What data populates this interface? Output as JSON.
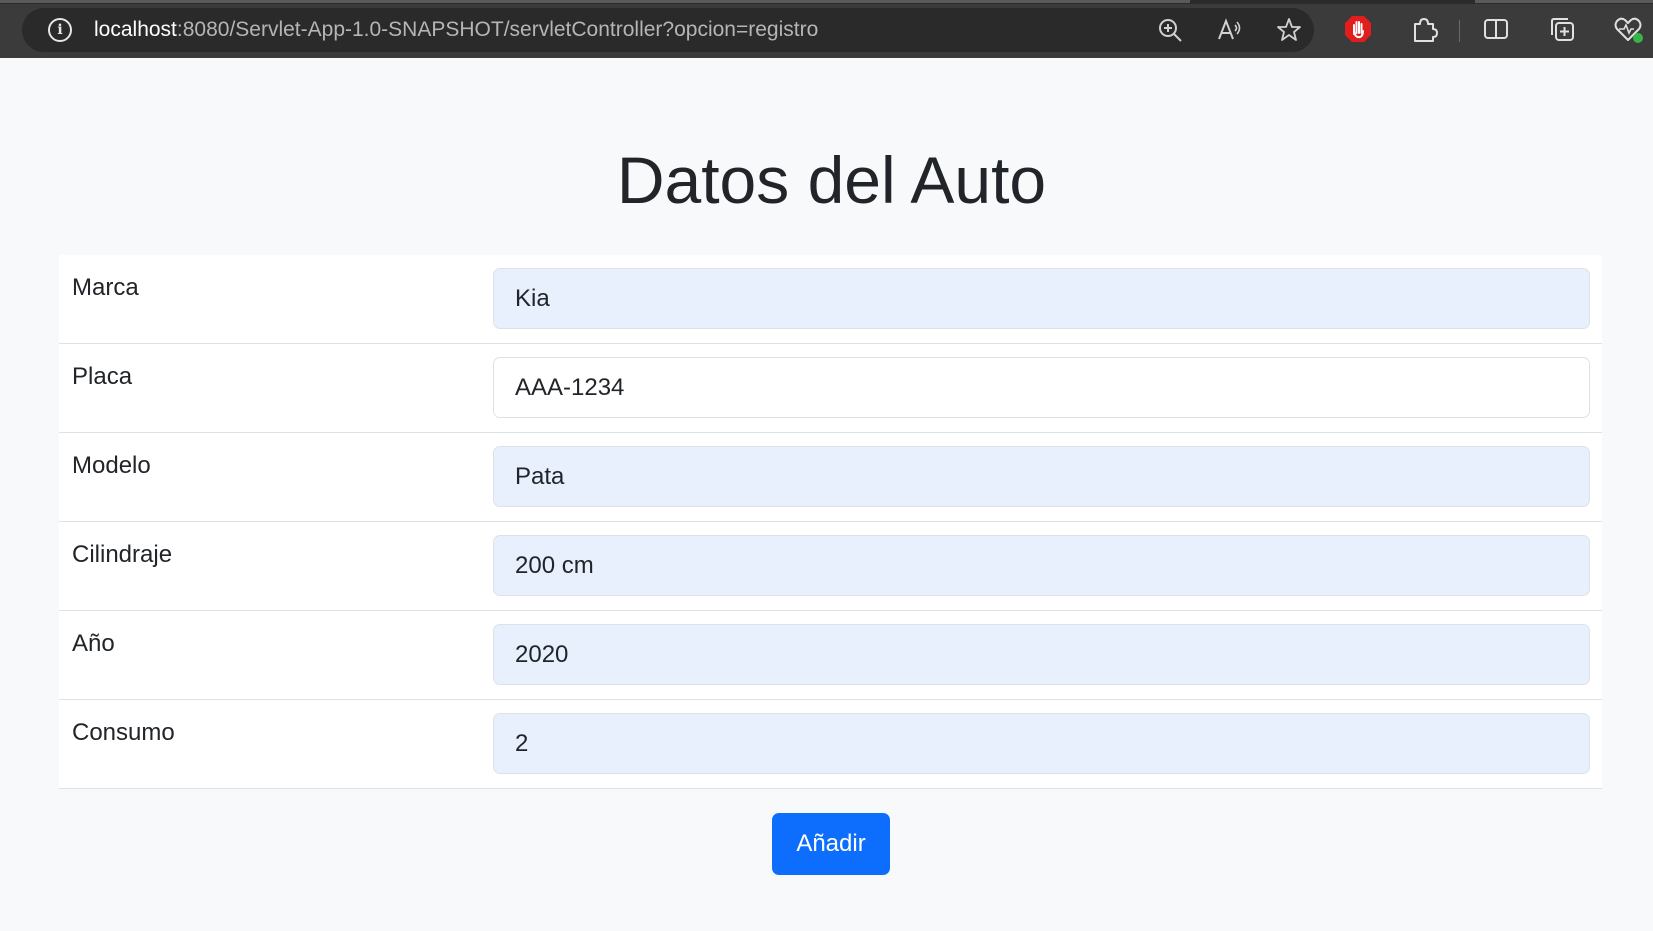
{
  "browser": {
    "url_host": "localhost",
    "url_path": ":8080/Servlet-App-1.0-SNAPSHOT/servletController?opcion=registro",
    "icons": [
      "info-icon",
      "zoom-icon",
      "read-aloud-icon",
      "favorite-star-icon",
      "adblock-icon",
      "extensions-icon",
      "split-screen-icon",
      "collections-icon",
      "performance-icon"
    ]
  },
  "page": {
    "title": "Datos del Auto"
  },
  "form": {
    "fields": [
      {
        "label": "Marca",
        "value": "Kia",
        "autofilled": true
      },
      {
        "label": "Placa",
        "value": "AAA-1234",
        "autofilled": false
      },
      {
        "label": "Modelo",
        "value": "Pata",
        "autofilled": true
      },
      {
        "label": "Cilindraje",
        "value": "200 cm",
        "autofilled": true
      },
      {
        "label": "Año",
        "value": "2020",
        "autofilled": true
      },
      {
        "label": "Consumo",
        "value": "2",
        "autofilled": true
      }
    ],
    "submit_label": "Añadir"
  },
  "colors": {
    "primary": "#0d6efd",
    "autofill_bg": "#e8f0fe",
    "page_bg": "#f8f9fa",
    "chrome_bg": "#3b3b3b"
  }
}
